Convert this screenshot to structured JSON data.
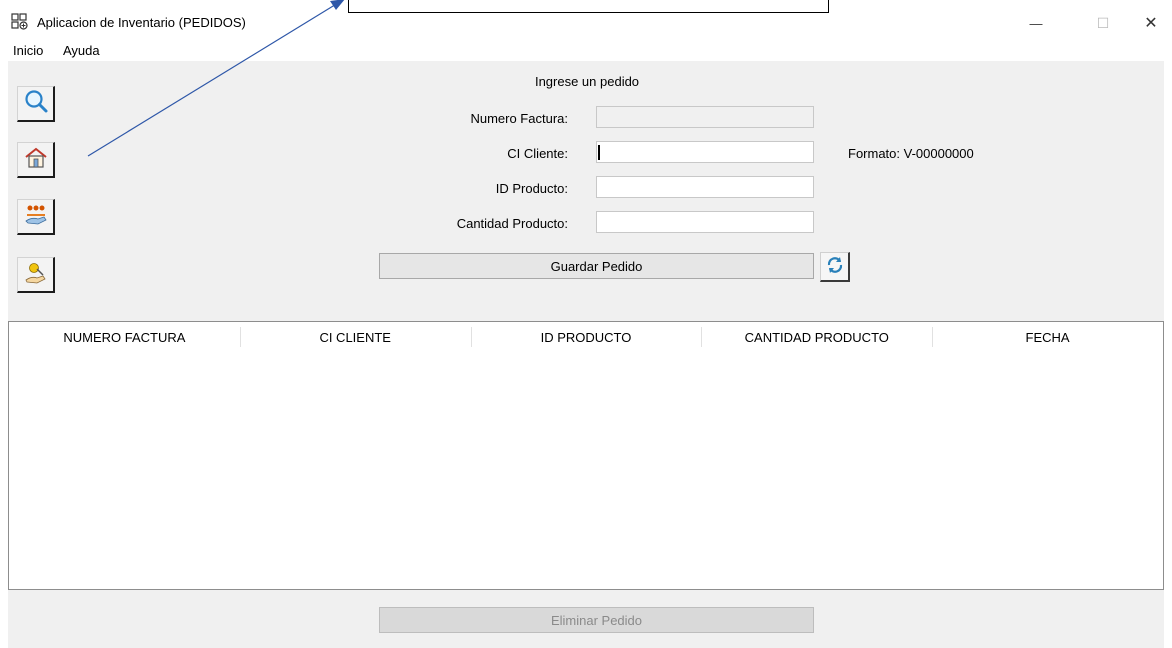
{
  "window": {
    "title": "Aplicacion de Inventario (PEDIDOS)",
    "minimize_glyph": "—",
    "maximize_glyph": "☐",
    "close_glyph": "✕"
  },
  "menu": {
    "items": [
      "Inicio",
      "Ayuda"
    ]
  },
  "sidebar": {
    "buttons": [
      {
        "icon": "search-icon"
      },
      {
        "icon": "home-icon"
      },
      {
        "icon": "customers-icon"
      },
      {
        "icon": "payment-icon"
      }
    ]
  },
  "form": {
    "heading": "Ingrese un pedido",
    "fields": [
      {
        "label": "Numero Factura:",
        "value": "",
        "disabled": true
      },
      {
        "label": "CI Cliente:",
        "value": "",
        "disabled": false
      },
      {
        "label": "ID Producto:",
        "value": "",
        "disabled": false
      },
      {
        "label": "Cantidad Producto:",
        "value": "",
        "disabled": false
      }
    ],
    "ci_hint": "Formato: V-00000000",
    "save_label": "Guardar Pedido",
    "refresh_icon": "refresh-icon"
  },
  "table": {
    "columns": [
      "NUMERO FACTURA",
      "CI CLIENTE",
      "ID PRODUCTO",
      "CANTIDAD PRODUCTO",
      "FECHA"
    ],
    "rows": []
  },
  "footer": {
    "delete_label": "Eliminar Pedido"
  },
  "colors": {
    "panel": "#f0f0f0",
    "annotation_arrow": "#2e57a8"
  }
}
